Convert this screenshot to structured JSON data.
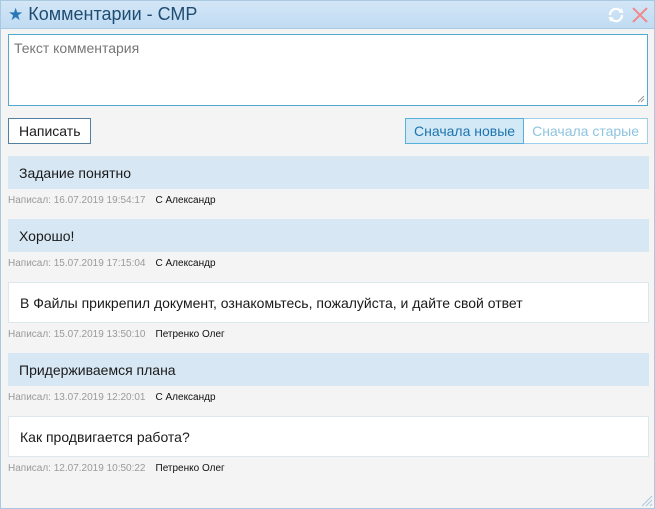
{
  "window": {
    "title": "Комментарии - СМР",
    "star_icon": "star-icon",
    "refresh_icon": "refresh-icon",
    "close_icon": "close-icon"
  },
  "comment_input": {
    "placeholder": "Текст комментария",
    "value": ""
  },
  "toolbar": {
    "post_label": "Написать",
    "sort_new_label": "Сначала новые",
    "sort_old_label": "Сначала старые",
    "active_sort": "new"
  },
  "comments": [
    {
      "text": "Задание понятно",
      "date": "Написал: 16.07.2019 19:54:17",
      "author": "С Александр",
      "style": "blue"
    },
    {
      "text": "Хорошо!",
      "date": "Написал: 15.07.2019 17:15:04",
      "author": "С Александр",
      "style": "blue"
    },
    {
      "text": "В Файлы прикрепил документ, ознакомьтесь, пожалуйста, и дайте свой ответ",
      "date": "Написал: 15.07.2019 13:50:10",
      "author": "Петренко Олег",
      "style": "white"
    },
    {
      "text": "Придерживаемся плана",
      "date": "Написал: 13.07.2019 12:20:01",
      "author": "С Александр",
      "style": "blue"
    },
    {
      "text": "Как продвигается работа?",
      "date": "Написал: 12.07.2019 10:50:22",
      "author": "Петренко Олег",
      "style": "white"
    }
  ],
  "colors": {
    "accent": "#2a77b8",
    "title_bar": "#c9e0f4",
    "own_comment_bg": "#d7e7f3",
    "close_icon": "#f08a8a"
  }
}
